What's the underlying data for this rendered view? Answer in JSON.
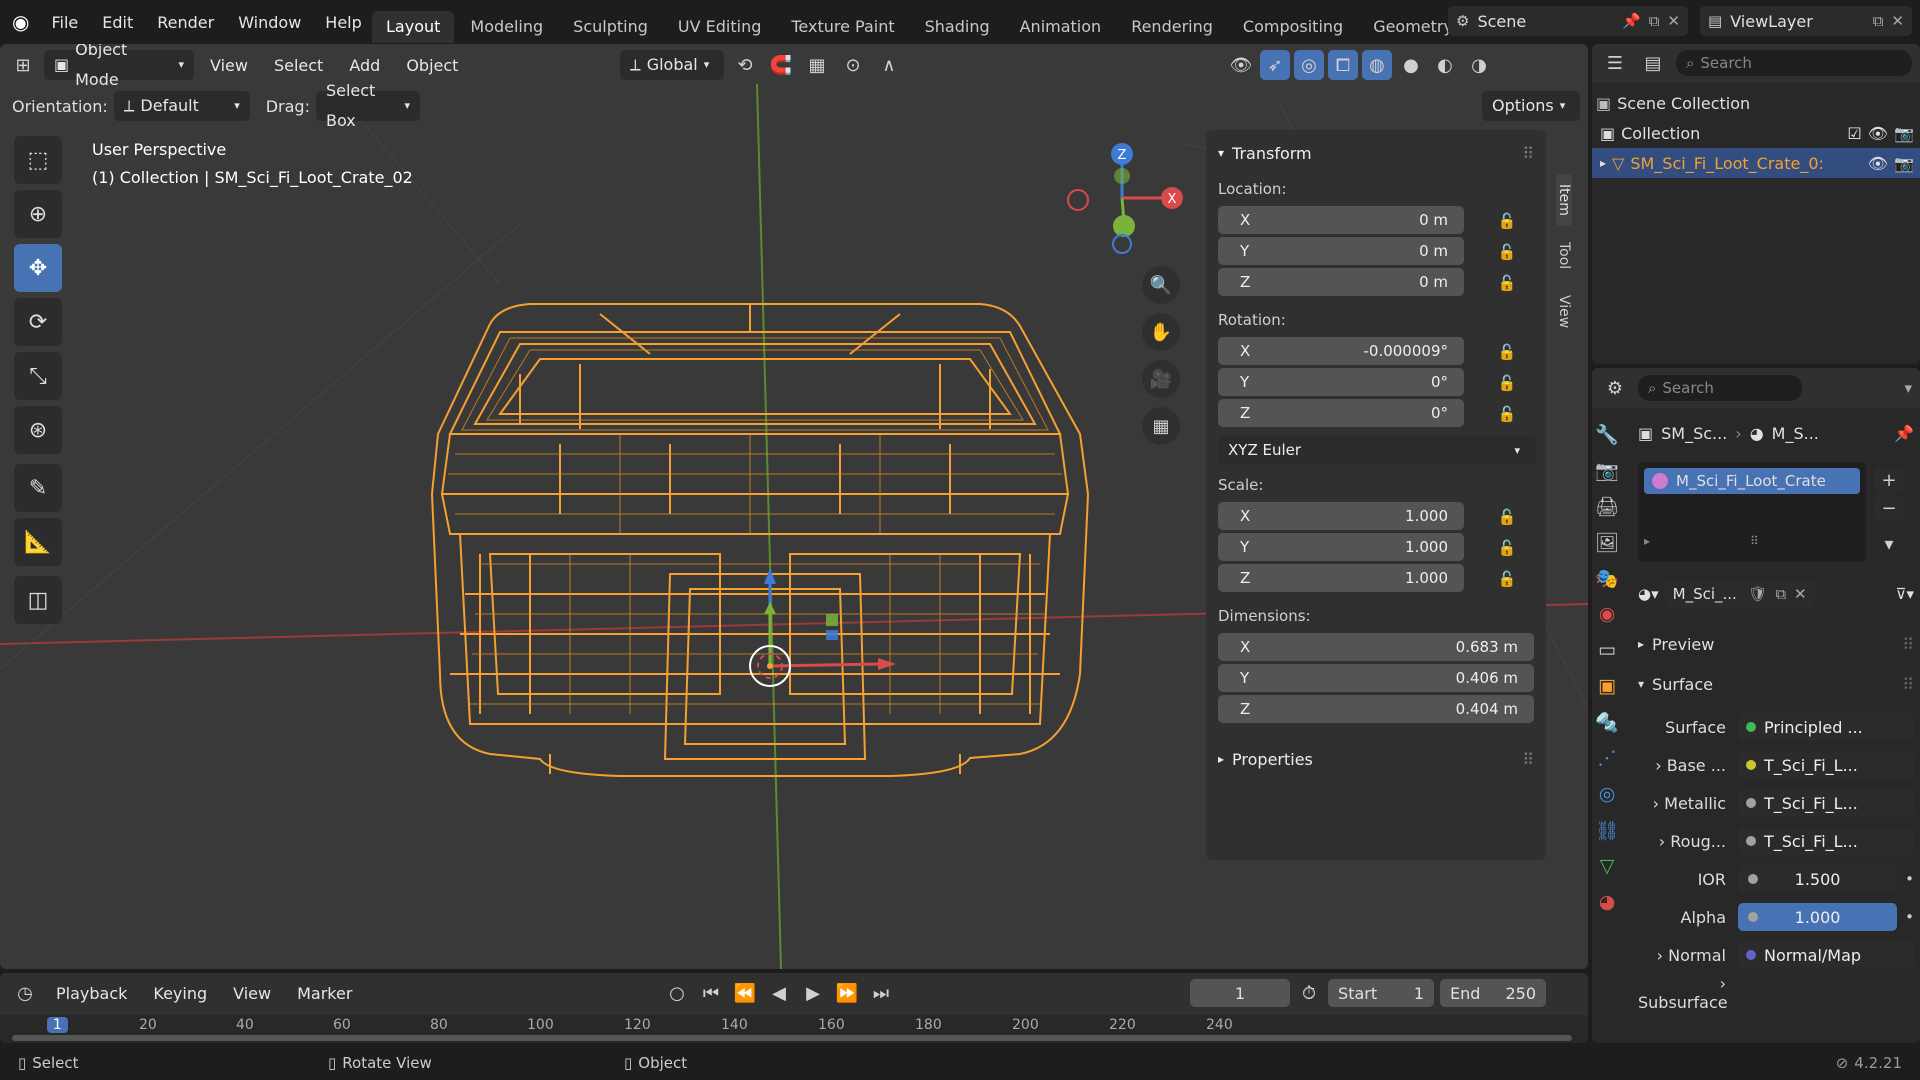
{
  "menu": [
    "File",
    "Edit",
    "Render",
    "Window",
    "Help"
  ],
  "workspaces": [
    "Layout",
    "Modeling",
    "Sculpting",
    "UV Editing",
    "Texture Paint",
    "Shading",
    "Animation",
    "Rendering",
    "Compositing",
    "Geometry Node"
  ],
  "scene": "Scene",
  "view_layer": "ViewLayer",
  "header": {
    "mode": "Object Mode",
    "view": "View",
    "select": "Select",
    "add": "Add",
    "object": "Object",
    "transform_orientation": "Global",
    "orientation_label": "Orientation:",
    "orientation_value": "Default",
    "drag_label": "Drag:",
    "drag_value": "Select Box",
    "options": "Options"
  },
  "viewport": {
    "perspective": "User Perspective",
    "info": "(1) Collection | SM_Sci_Fi_Loot_Crate_02",
    "gizmo": {
      "x": "X",
      "y": "Y",
      "z": "Z"
    }
  },
  "npanel": {
    "tabs": [
      "Item",
      "Tool",
      "View"
    ],
    "transform": "Transform",
    "location_label": "Location:",
    "location": [
      {
        "axis": "X",
        "value": "0 m"
      },
      {
        "axis": "Y",
        "value": "0 m"
      },
      {
        "axis": "Z",
        "value": "0 m"
      }
    ],
    "rotation_label": "Rotation:",
    "rotation": [
      {
        "axis": "X",
        "value": "-0.000009°"
      },
      {
        "axis": "Y",
        "value": "0°"
      },
      {
        "axis": "Z",
        "value": "0°"
      }
    ],
    "rotation_mode": "XYZ Euler",
    "scale_label": "Scale:",
    "scale": [
      {
        "axis": "X",
        "value": "1.000"
      },
      {
        "axis": "Y",
        "value": "1.000"
      },
      {
        "axis": "Z",
        "value": "1.000"
      }
    ],
    "dimensions_label": "Dimensions:",
    "dimensions": [
      {
        "axis": "X",
        "value": "0.683 m"
      },
      {
        "axis": "Y",
        "value": "0.406 m"
      },
      {
        "axis": "Z",
        "value": "0.404 m"
      }
    ],
    "properties": "Properties"
  },
  "outliner": {
    "search_placeholder": "Search",
    "scene_collection": "Scene Collection",
    "collection": "Collection",
    "object": "SM_Sci_Fi_Loot_Crate_0:"
  },
  "properties": {
    "search_placeholder": "Search",
    "breadcrumb_object": "SM_Sc...",
    "breadcrumb_material": "M_S...",
    "material_slot": "M_Sci_Fi_Loot_Crate",
    "material_name": "M_Sci_...",
    "preview": "Preview",
    "surface_section": "Surface",
    "rows": [
      {
        "label": "Surface",
        "value": "Principled ...",
        "dot": "#3dbb55"
      },
      {
        "label": "Base ...",
        "value": "T_Sci_Fi_L...",
        "dot": "#c7c729"
      },
      {
        "label": "Metallic",
        "value": "T_Sci_Fi_L...",
        "dot": "#a1a1a1"
      },
      {
        "label": "Roug...",
        "value": "T_Sci_Fi_L...",
        "dot": "#a1a1a1"
      },
      {
        "label": "IOR",
        "value": "1.500",
        "dot": "#a1a1a1"
      },
      {
        "label": "Alpha",
        "value": "1.000",
        "dot": "#a1a1a1"
      },
      {
        "label": "Normal",
        "value": "Normal/Map",
        "dot": "#6363c7"
      },
      {
        "label": "Subsurface",
        "value": "",
        "dot": ""
      }
    ]
  },
  "timeline": {
    "playback": "Playback",
    "keying": "Keying",
    "view": "View",
    "marker": "Marker",
    "current_frame": "1",
    "start_label": "Start",
    "start": "1",
    "end_label": "End",
    "end": "250",
    "ticks": [
      "1",
      "20",
      "40",
      "60",
      "80",
      "100",
      "120",
      "140",
      "160",
      "180",
      "200",
      "220",
      "240"
    ]
  },
  "statusbar": {
    "select": "Select",
    "rotate": "Rotate View",
    "object": "Object",
    "version": "4.2.21"
  },
  "colors": {
    "accent": "#4772b3",
    "selection": "#f5a030",
    "axis_x": "#d94a4a",
    "axis_y": "#7ab33a",
    "axis_z": "#3d7bd6"
  }
}
